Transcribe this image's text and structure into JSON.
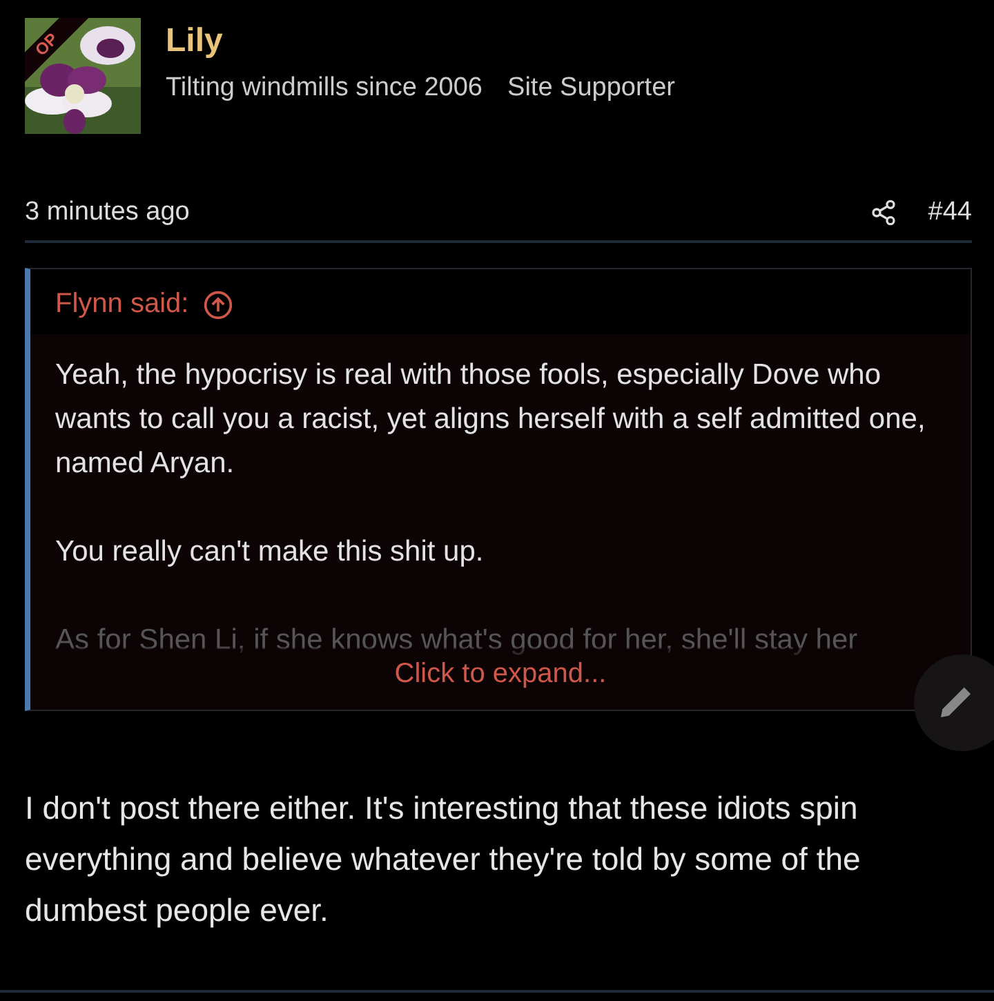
{
  "author": {
    "name": "Lily",
    "badge": "OP",
    "title": "Tilting windmills since 2006",
    "banner": "Site Supporter"
  },
  "post": {
    "time": "3 minutes ago",
    "number": "#44"
  },
  "quote": {
    "attribution": "Flynn said:",
    "paragraphs": [
      "Yeah, the hypocrisy is real with those fools, especially Dove who wants to call you a racist, yet aligns herself with a self admitted one, named Aryan.",
      "You really can't make this shit up.",
      "As for Shen Li, if she knows what's good for her, she'll stay her"
    ],
    "expand": "Click to expand..."
  },
  "body": "I don't post there either. It's interesting that these idiots spin everything and believe whatever they're told by some of the dumbest people ever."
}
